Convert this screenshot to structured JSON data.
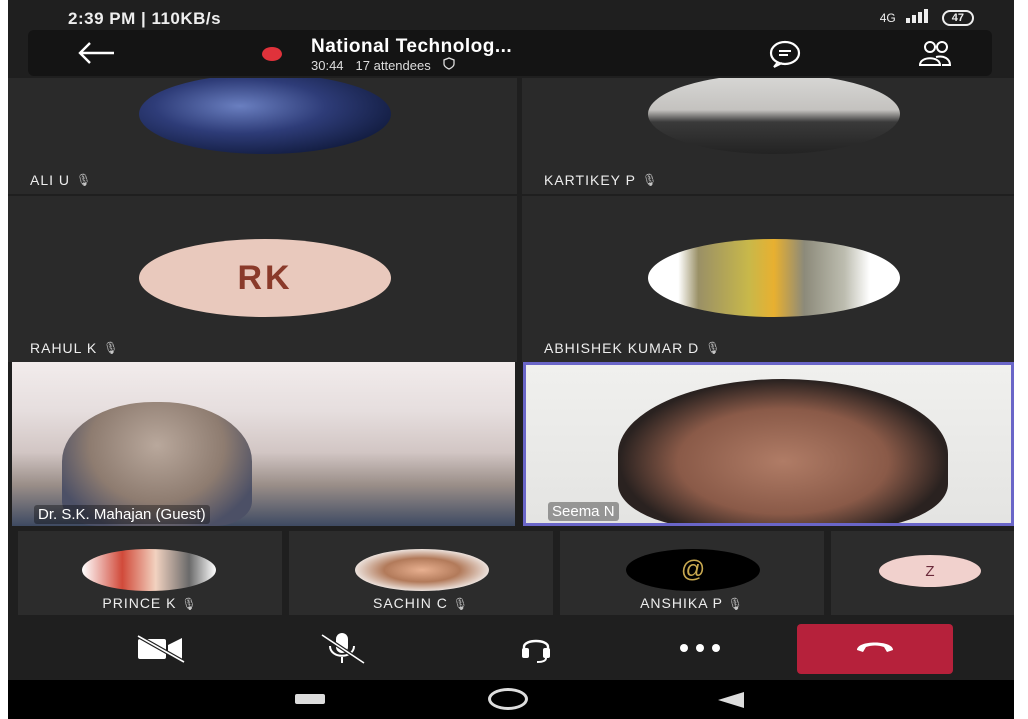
{
  "status_bar": {
    "time_speed": "2:39 PM | 110KB/s",
    "network": "4G",
    "battery": "47"
  },
  "meeting": {
    "title": "National Technolog...",
    "duration": "30:44",
    "attendees": "17 attendees"
  },
  "participants": {
    "ali": "ALI U",
    "kartikey": "KARTIKEY P",
    "rahul": "RAHUL K",
    "rahul_initials": "RK",
    "abhishek": "ABHISHEK KUMAR D",
    "mahajan": "Dr. S.K. Mahajan (Guest)",
    "seema": "Seema N",
    "prince": "PRINCE K",
    "sachin": "SACHIN C",
    "anshika": "ANSHIKA P",
    "z_initial": "Z"
  },
  "icons": {
    "back": "arrow-left-icon",
    "recording": "record-icon",
    "chat": "chat-icon",
    "people": "people-icon",
    "camera_off": "camera-off-icon",
    "mic_off": "mic-off-icon",
    "audio": "headset-icon",
    "more": "more-icon",
    "hangup": "hangup-icon"
  },
  "colors": {
    "hangup": "#b6213b",
    "active_speaker_border": "#6a66c8",
    "record": "#e0323b"
  }
}
